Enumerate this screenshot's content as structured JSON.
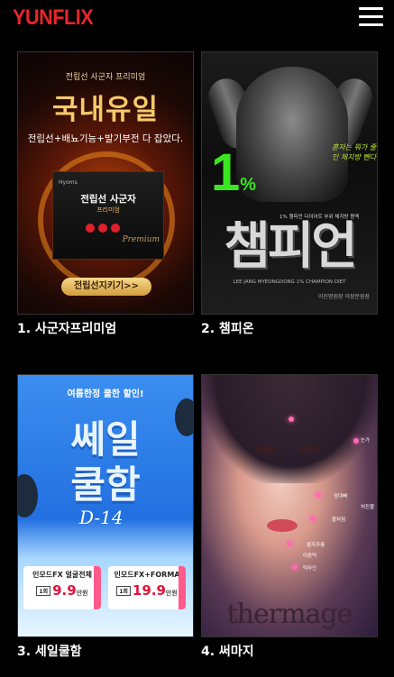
{
  "header": {
    "logo": "YUNFLIX",
    "menu_icon": "hamburger-menu-icon"
  },
  "cards": [
    {
      "caption": "1. 사군자프리미엄",
      "ad": {
        "top_line": "전립선 사군자 프리미엄",
        "headline": "국내유일",
        "subline": "전립선+배뇨기능+발기부전 다 잡았다.",
        "box_brand": "Hyoms",
        "box_title": "전립선 사군자",
        "box_sub": "프리미엄",
        "box_script": "Premium",
        "button": "전립선지키기>>"
      }
    },
    {
      "caption": "2. 챔피온",
      "ad": {
        "percent": "1",
        "percent_sign": "%",
        "side_text": "혼자는 뭐가 줄인 체지방 뺀다",
        "mid_text": "1% 챔피언 다이어트 부위 체지방 몸엑",
        "headline": "챔피언",
        "english": "LEE JANG MYEONGDONG 1% CHAMPION DIET",
        "footer": "이진명원장 이장문원장"
      }
    },
    {
      "caption": "3. 세일쿨함",
      "ad": {
        "top_line": "여름한정 쿨한 할인!",
        "headline_1": "쎄일",
        "headline_2": "쿨함",
        "dday": "D-14",
        "coupons": [
          {
            "name": "인모드FX 얼굴전체",
            "tag": "1회",
            "price": "9.9",
            "unit": "만원"
          },
          {
            "name": "인모드FX+FORMA",
            "tag": "1회",
            "price": "19.9",
            "unit": "만원"
          }
        ]
      }
    },
    {
      "caption": "4. 써마지",
      "ad": {
        "labels": [
          "눈가",
          "광대뼈",
          "처진볼",
          "볼처짐",
          "팔자주름",
          "턱라인",
          "이중턱"
        ],
        "brand": "thermage"
      }
    }
  ]
}
